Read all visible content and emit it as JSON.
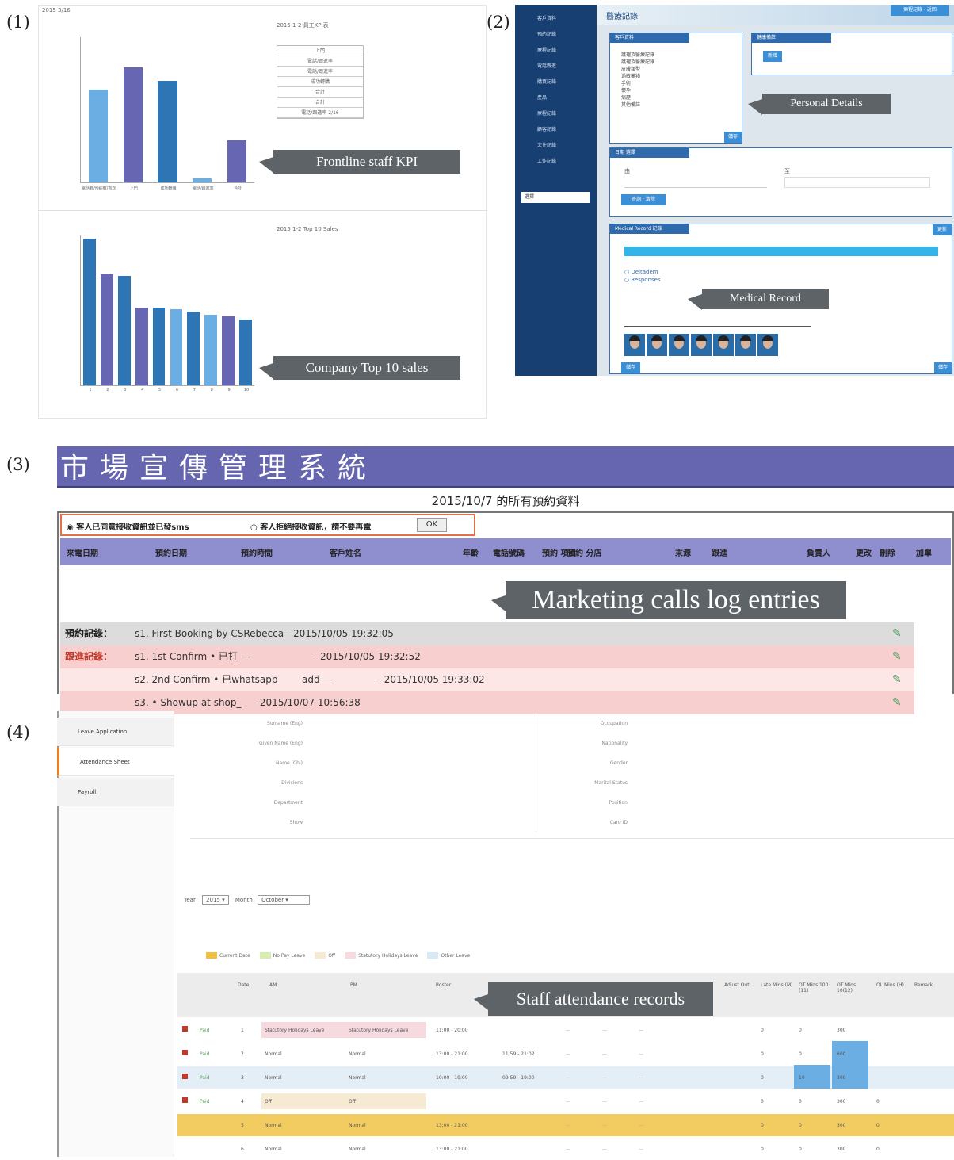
{
  "panel_labels": [
    "(1)",
    "(2)",
    "(3)",
    "(4)"
  ],
  "panel1": {
    "corner": "2015 3/16",
    "callout_kpi": "Frontline staff KPI",
    "callout_sales": "Company Top 10 sales",
    "kpi_chart": {
      "title": "2015 1-2 員工KPI表",
      "bar_values": [
        64,
        79,
        70,
        3,
        29
      ],
      "bar_colors": [
        "#6aaee4",
        "#6666b3",
        "#2e75b6",
        "#6aaee4",
        "#6666b3"
      ],
      "xlabels": [
        "電話數/預約數/首次到訪",
        "上門",
        "成功轉購",
        "電話/跟進率",
        "合計"
      ]
    },
    "kpi_table": [
      "上門",
      "電話/跟進率",
      "電話/跟進率",
      "成功轉購",
      "合計",
      "合計",
      "電話/跟進率 2/16"
    ],
    "sales_chart": {
      "title": "2015 1-2 Top 10 Sales",
      "bar_values": [
        98,
        74,
        73,
        52,
        52,
        51,
        49,
        47,
        46,
        44
      ],
      "bar_colors": [
        "#2e75b6",
        "#6666b3",
        "#2e75b6",
        "#6666b3",
        "#2e75b6",
        "#6aaee4",
        "#2e75b6",
        "#6aaee4",
        "#6666b3",
        "#2e75b6"
      ],
      "xlabels": [
        "1",
        "2",
        "3",
        "4",
        "5",
        "6",
        "7",
        "8",
        "9",
        "10"
      ]
    }
  },
  "panel2": {
    "page_title": "醫療記錄",
    "top_button": "療程記錄 · 返回",
    "nav": [
      "客戶資料",
      "預約記錄",
      "療程記錄",
      "電話跟進",
      "購買記錄",
      "產品",
      "療程紀錄",
      "顧客記錄",
      "文件記錄",
      "工作記錄"
    ],
    "nav_select": "選擇",
    "personal_box_title": "客戶資料",
    "personal_lines": [
      "護理及醫療記錄",
      "護理及醫療記錄",
      "皮膚類型",
      "過敏藥物",
      "手術",
      "懷孕",
      "病歷",
      "其他備註"
    ],
    "side_box_title": "健康備註",
    "box_button": "新增",
    "save_button": "儲存",
    "date_box_title": "日期 選擇",
    "date_from": "由",
    "date_to": "至",
    "query_button": "查詢 · 清除",
    "medical_box_title": "Medical Record 記錄",
    "medical_button": "更新",
    "radio1": "Deltadem",
    "radio2": "Responses",
    "callout_personal": "Personal Details",
    "callout_medical": "Medical Record"
  },
  "panel3": {
    "system_title": "市場宣傳管理系統",
    "date_heading": "2015/10/7 的所有預約資料",
    "radio_a": "客人已同意接收資訊並已發sms",
    "radio_b": "客人拒絕接收資訊，請不要再電",
    "ok_button": "OK",
    "headers": [
      "來電日期",
      "預約日期",
      "預約時間",
      "客戶姓名",
      "年齡",
      "電話號碼",
      "預約 項目",
      "預約 分店",
      "來源",
      "跟進",
      "負責人",
      "更改",
      "刪除",
      "加單"
    ],
    "callout": "Marketing calls log entries",
    "rows": [
      {
        "label": "預約記錄：",
        "text": "s1. First Booking by CSRebecca - 2015/10/05 19:32:05"
      },
      {
        "label": "跟進記錄：",
        "text": "s1. 1st Confirm • 已打 —                     - 2015/10/05 19:32:52"
      },
      {
        "label": "",
        "text": "s2. 2nd Confirm • 已whatsapp        add —               - 2015/10/05 19:33:02"
      },
      {
        "label": "",
        "text": "s3. • Showup at shop_    - 2015/10/07 10:56:38"
      }
    ]
  },
  "panel4": {
    "nav": [
      "Leave Application",
      "Attendance Sheet",
      "Payroll"
    ],
    "form_left": [
      "Surname (Eng)",
      "Given Name (Eng)",
      "Name (Chi)",
      "Divisions",
      "Department",
      "Show"
    ],
    "form_right": [
      "Occupation",
      "Nationality",
      "Gender",
      "Marital Status",
      "Position",
      "Card ID"
    ],
    "year_label": "Year",
    "year_value": "2015",
    "month_label": "Month",
    "month_value": "October",
    "legend": [
      "Current Date",
      "No Pay Leave",
      "Off",
      "Statutory Holidays Leave",
      "Other Leave"
    ],
    "legend_colors": [
      "#f0c040",
      "#d6ecb0",
      "#f6ead2",
      "#f7d9e0",
      "#d6eaf6"
    ],
    "headers": [
      "Date",
      "AM",
      "PM",
      "Roster",
      "Adjust Out",
      "Late Mins (M)",
      "OT Mins 100 (11)",
      "OT Mins 10(12)",
      "OL Mins (H)",
      "Remark"
    ],
    "callout": "Staff attendance records",
    "rows": [
      {
        "flag": "Paid",
        "date": "1",
        "am": "Statutory Holidays Leave",
        "pm": "Statutory Holidays Leave",
        "roster": "11:00 - 20:00",
        "time": "",
        "v1": "0",
        "v2": "0",
        "v3": "300",
        "v4": "",
        "bg": "#ffffff"
      },
      {
        "flag": "Paid",
        "date": "2",
        "am": "Normal",
        "pm": "Normal",
        "roster": "13:00 - 21:00",
        "time": "11:59 - 21:02",
        "v1": "0",
        "v2": "0",
        "v3": "600",
        "v4": "",
        "bg": "#ffffff"
      },
      {
        "flag": "Paid",
        "date": "3",
        "am": "Normal",
        "pm": "Normal",
        "roster": "10:00 - 19:00",
        "time": "09:59 - 19:00",
        "v1": "0",
        "v2": "10",
        "v3": "300",
        "v4": "",
        "bg": "#e4eef6"
      },
      {
        "flag": "Paid",
        "date": "4",
        "am": "Off",
        "pm": "Off",
        "roster": "",
        "time": "",
        "v1": "0",
        "v2": "0",
        "v3": "300",
        "v4": "0",
        "bg": "#ffffff"
      },
      {
        "flag": "",
        "date": "5",
        "am": "Normal",
        "pm": "Normal",
        "roster": "13:00 - 21:00",
        "time": "",
        "v1": "0",
        "v2": "0",
        "v3": "300",
        "v4": "0",
        "bg": "#f2cc60"
      },
      {
        "flag": "",
        "date": "6",
        "am": "Normal",
        "pm": "Normal",
        "roster": "13:00 - 21:00",
        "time": "",
        "v1": "0",
        "v2": "0",
        "v3": "300",
        "v4": "0",
        "bg": "#ffffff"
      }
    ]
  }
}
